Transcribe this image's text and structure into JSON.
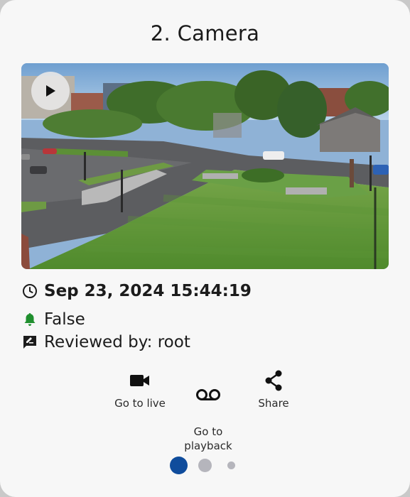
{
  "card": {
    "title": "2. Camera",
    "timestamp": "Sep 23, 2024 15:44:19",
    "alarm_status": "False",
    "reviewed_by": "Reviewed by: root"
  },
  "actions": [
    {
      "label": "Go to live",
      "icon": "video-camera-icon"
    },
    {
      "label": "Go to\nplayback",
      "icon": "voicemail-playback-icon"
    },
    {
      "label": "Share",
      "icon": "share-icon"
    }
  ],
  "pagination": {
    "pages": 3,
    "active": 1
  },
  "colors": {
    "accent": "#0f4c9c",
    "alarm_green": "#1f8f2e",
    "inactive_dot": "#b5b5bc"
  }
}
